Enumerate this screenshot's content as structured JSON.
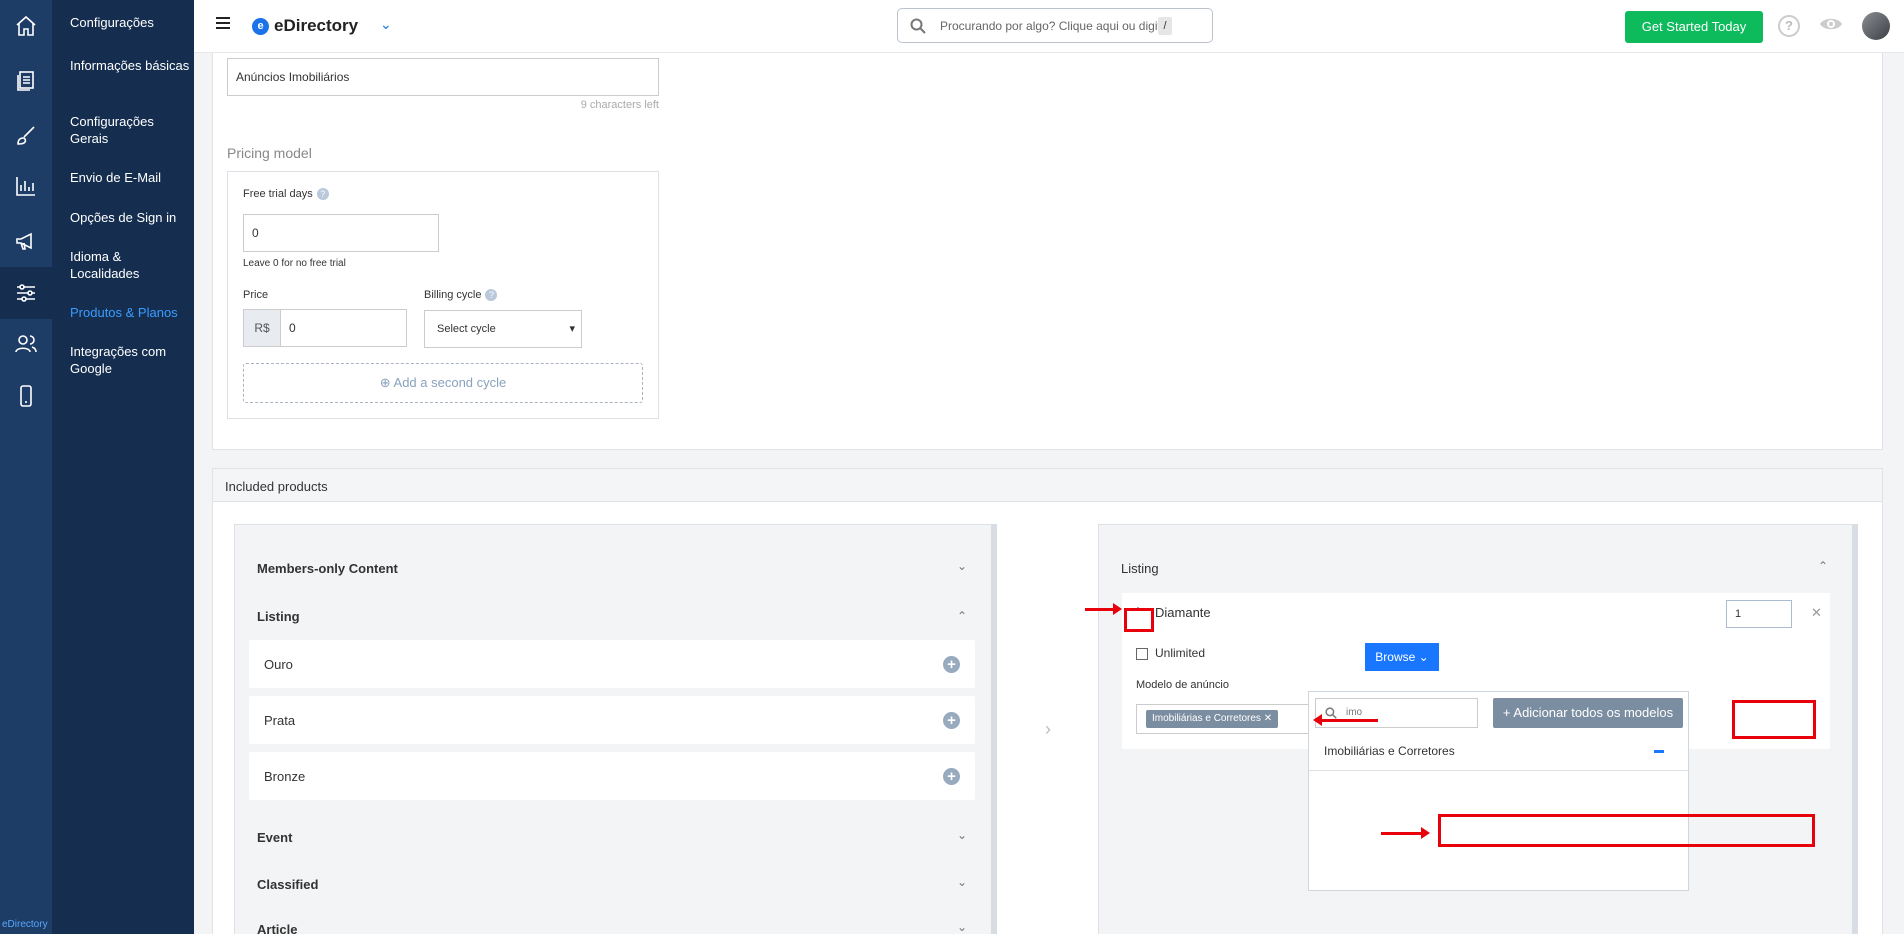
{
  "rail": {
    "items": [
      "home-icon",
      "document-icon",
      "brush-icon",
      "chart-icon",
      "megaphone-icon",
      "settings-sliders-icon",
      "users-icon",
      "mobile-icon"
    ],
    "brand": "eDirectory"
  },
  "subnav": {
    "title": "Configurações",
    "items": [
      {
        "label": "Informações básicas"
      },
      {
        "label": "Configurações Gerais"
      },
      {
        "label": "Envio de E-Mail"
      },
      {
        "label": "Opções de Sign in"
      },
      {
        "label": "Idioma & Localidades"
      },
      {
        "label": "Produtos & Planos"
      },
      {
        "label": "Integrações com Google"
      }
    ]
  },
  "header": {
    "logo": "eDirectory",
    "logo_mark": "e",
    "search_placeholder": "Procurando por algo? Clique aqui ou digite",
    "search_shortcut": "/",
    "cta": "Get Started Today",
    "help": "?"
  },
  "pricing": {
    "plan_name": "Anúncios Imobiliários",
    "chars_left": "9 characters left",
    "section_title": "Pricing model",
    "free_trial_label": "Free trial days",
    "free_trial_value": "0",
    "free_trial_hint": "Leave 0 for no free trial",
    "price_label": "Price",
    "currency": "R$",
    "price_value": "0",
    "billing_label": "Billing cycle",
    "billing_value": "Select cycle",
    "add_cycle": "Add a second cycle"
  },
  "included": {
    "title": "Included products",
    "left": {
      "sections": [
        "Members-only Content",
        "Listing",
        "Event",
        "Classified",
        "Article"
      ],
      "listing_items": [
        "Ouro",
        "Prata",
        "Bronze"
      ]
    },
    "right": {
      "section": "Listing",
      "item": "Diamante",
      "quantity": "1",
      "unlimited_label": "Unlimited",
      "model_label": "Modelo de anúncio",
      "model_tag": "Imobiliárias e Corretores",
      "browse": "Browse",
      "dropdown": {
        "search_value": "imo",
        "add_all": "+ Adicionar todos os modelos",
        "item": "Imobiliárias e Corretores"
      }
    }
  },
  "colors": {
    "rail": "#1d3c66",
    "subnav": "#152e50",
    "accent": "#1976ff",
    "cta": "#0dbb5c",
    "annotation": "#e8000b"
  }
}
